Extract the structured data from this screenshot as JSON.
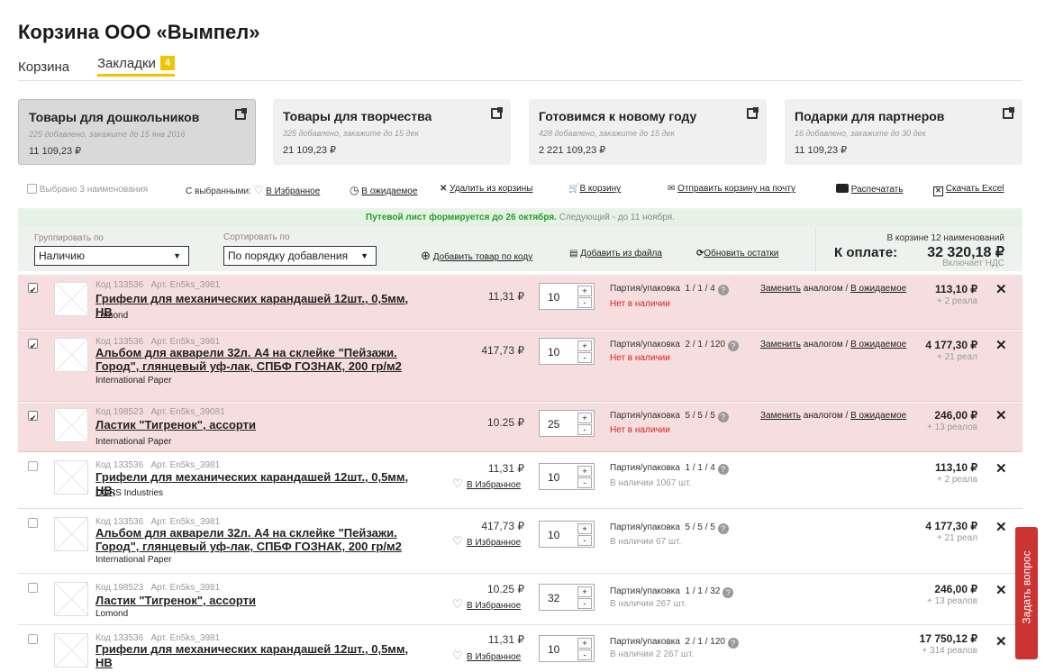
{
  "page_title": "Корзина ООО «Вымпел»",
  "tabs": [
    {
      "label": "Корзина"
    },
    {
      "label": "Закладки",
      "badge": "4"
    }
  ],
  "lists": [
    {
      "name": "Товары для дошкольников",
      "sub": "225 добавлено, закажите до 15 янв 2016",
      "sum": "11 109,23 ₽"
    },
    {
      "name": "Товары для творчества",
      "sub": "325 добавлено, закажите до 15 дек",
      "sum": "21 109,23 ₽"
    },
    {
      "name": "Готовимся к новому году",
      "sub": "428 добавлено, закажите до 15 дек",
      "sum": "2 221 109,23 ₽"
    },
    {
      "name": "Подарки для партнеров",
      "sub": "16 добавлено, закажите до 30 дек",
      "sum": "11 109,23 ₽"
    }
  ],
  "actions": {
    "selected": "Выбрано",
    "selected_count": "3 наименования",
    "with_selected": "С выбранными:",
    "to_fav": "В Избранное",
    "to_wait": "В ожидаемое",
    "remove": "Удалить из корзины",
    "to_cart": "В корзину",
    "send": "Отправить корзину на почту",
    "print": "Распечатать",
    "download": "Скачать Excel"
  },
  "banner": {
    "bold": "Путевой лист формируется до 26 октября.",
    "rest": " Следующий - до 11 ноября."
  },
  "controls": {
    "group_label": "Группировать по",
    "group_value": "Наличию",
    "sort_label": "Сортировать  по",
    "sort_value": "По порядку добавления",
    "add_code": "Добавить товар по коду",
    "add_file": "Добавить из файла",
    "refresh": "Обновить остатки"
  },
  "total": {
    "count": "В корзине 12 наименований",
    "label": "К оплате:",
    "value": "32 320,18 ₽",
    "vat": "Включает НДС"
  },
  "common": {
    "fav": "В Избранное",
    "pack": "Партия/упаковка",
    "replace": "Заменить",
    "replace_rest": " аналогом / ",
    "wait": "В ожидаемое"
  },
  "rows": [
    {
      "checked": true,
      "code": "Код 133536",
      "art": "Арт. En5ks_3981",
      "name": "Грифели для механических карандашей 12шт., 0,5мм, HB",
      "brand": "Lomond",
      "price": "11,31 ₽",
      "qty": "10",
      "pack": "1 / 1 / 4",
      "stock": "Нет в наличии",
      "sum": "113,10 ₽",
      "bonus": "+ 2 реала"
    },
    {
      "checked": true,
      "code": "Код 133536",
      "art": "Арт. En5ks_3981",
      "name": "Альбом для акварели 32л. А4 на склейке \"Пейзажи. Город\", глянцевый уф-лак, СПБФ ГОЗНАК, 200 гр/м2",
      "brand": "International Paper",
      "price": "417,73 ₽",
      "qty": "10",
      "pack": "2 / 1 / 120",
      "stock": "Нет в наличии",
      "sum": "4 177,30 ₽",
      "bonus": "+ 21 реал"
    },
    {
      "checked": true,
      "code": "Код 198523",
      "art": "Арт. En5ks_39081",
      "name": "Ластик \"Тигренок\", ассорти",
      "brand": "International Paper",
      "price": "10.25 ₽",
      "qty": "25",
      "pack": "5 / 5 / 5",
      "stock": "Нет в наличии",
      "sum": "246,00 ₽",
      "bonus": "+ 13 реалов"
    },
    {
      "checked": false,
      "code": "Код 133536",
      "art": "Арт. En5ks_3981",
      "name": "Грифели для механических карандашей 12шт., 0,5мм, HB,",
      "brand": "DORS Industries",
      "price": "11,31 ₽",
      "qty": "10",
      "pack": "1 / 1 / 4",
      "stock": "В наличии 1067 шт.",
      "sum": "113,10 ₽",
      "bonus": "+ 2 реала"
    },
    {
      "checked": false,
      "code": "Код 133536",
      "art": "Арт. En5ks_3981",
      "name": "Альбом для акварели 32л. А4 на склейке \"Пейзажи. Город\", глянцевый уф-лак, СПБФ ГОЗНАК, 200 гр/м2",
      "brand": "International Paper",
      "price": "417,73 ₽",
      "qty": "10",
      "pack": "5 / 5 / 5",
      "stock": "В наличии 67 шт.",
      "sum": "4 177,30 ₽",
      "bonus": "+ 21 реал"
    },
    {
      "checked": false,
      "code": "Код 198523",
      "art": "Арт. En5ks_3981",
      "name": "Ластик \"Тигренок\", ассорти",
      "brand": "Lomond",
      "price": "10.25 ₽",
      "qty": "32",
      "pack": "1 / 1 / 32",
      "stock": "В наличии 267 шт.",
      "sum": "246,00 ₽",
      "bonus": "+ 13 реалов"
    },
    {
      "checked": false,
      "code": "Код 133536",
      "art": "Арт. En5ks_3981",
      "name": "Грифели для механических карандашей 12шт., 0,5мм, HB",
      "brand": "",
      "price": "11,31 ₽",
      "qty": "10",
      "pack": "2 / 1 / 120",
      "stock": "В наличии 2 267 шт.",
      "sum": "17 750,12 ₽",
      "bonus": "+ 314 реалов"
    }
  ],
  "ask_button": "Задать вопрос",
  "colors": {
    "accent": "#f5c400",
    "highlight": "#f6dede",
    "green": "#2a9a2a",
    "danger": "#dd2222"
  }
}
